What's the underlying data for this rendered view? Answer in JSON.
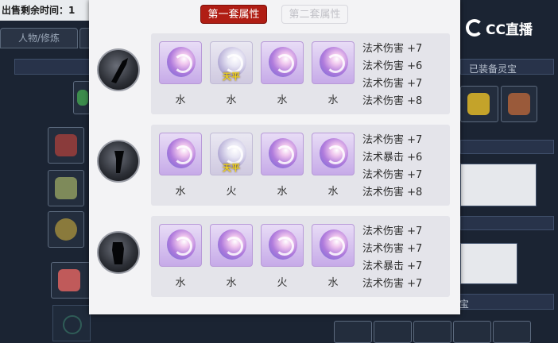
{
  "background": {
    "sale_time_label": "出售剩余时间：1",
    "tab_character": "人物/修炼",
    "tab_partial": "",
    "equipped_label": "已装备灵宝",
    "bottom_label": "灵宝"
  },
  "watermark": {
    "text": "CC直播"
  },
  "dialog": {
    "set1_label": "第一套属性",
    "set2_label": "第二套属性",
    "rows": [
      {
        "gems": [
          {
            "element": "水",
            "tag": ""
          },
          {
            "element": "水",
            "tag": "天平"
          },
          {
            "element": "水",
            "tag": ""
          },
          {
            "element": "水",
            "tag": ""
          }
        ],
        "attrs": [
          "法术伤害 +7",
          "法术伤害 +6",
          "法术伤害 +7",
          "法术伤害 +8"
        ]
      },
      {
        "gems": [
          {
            "element": "水",
            "tag": ""
          },
          {
            "element": "火",
            "tag": "天平"
          },
          {
            "element": "水",
            "tag": ""
          },
          {
            "element": "水",
            "tag": ""
          }
        ],
        "attrs": [
          "法术伤害 +7",
          "法术暴击 +6",
          "法术伤害 +7",
          "法术伤害 +8"
        ]
      },
      {
        "gems": [
          {
            "element": "水",
            "tag": ""
          },
          {
            "element": "水",
            "tag": ""
          },
          {
            "element": "火",
            "tag": ""
          },
          {
            "element": "水",
            "tag": ""
          }
        ],
        "attrs": [
          "法术伤害 +7",
          "法术伤害 +7",
          "法术暴击 +7",
          "法术伤害 +7"
        ]
      }
    ]
  }
}
